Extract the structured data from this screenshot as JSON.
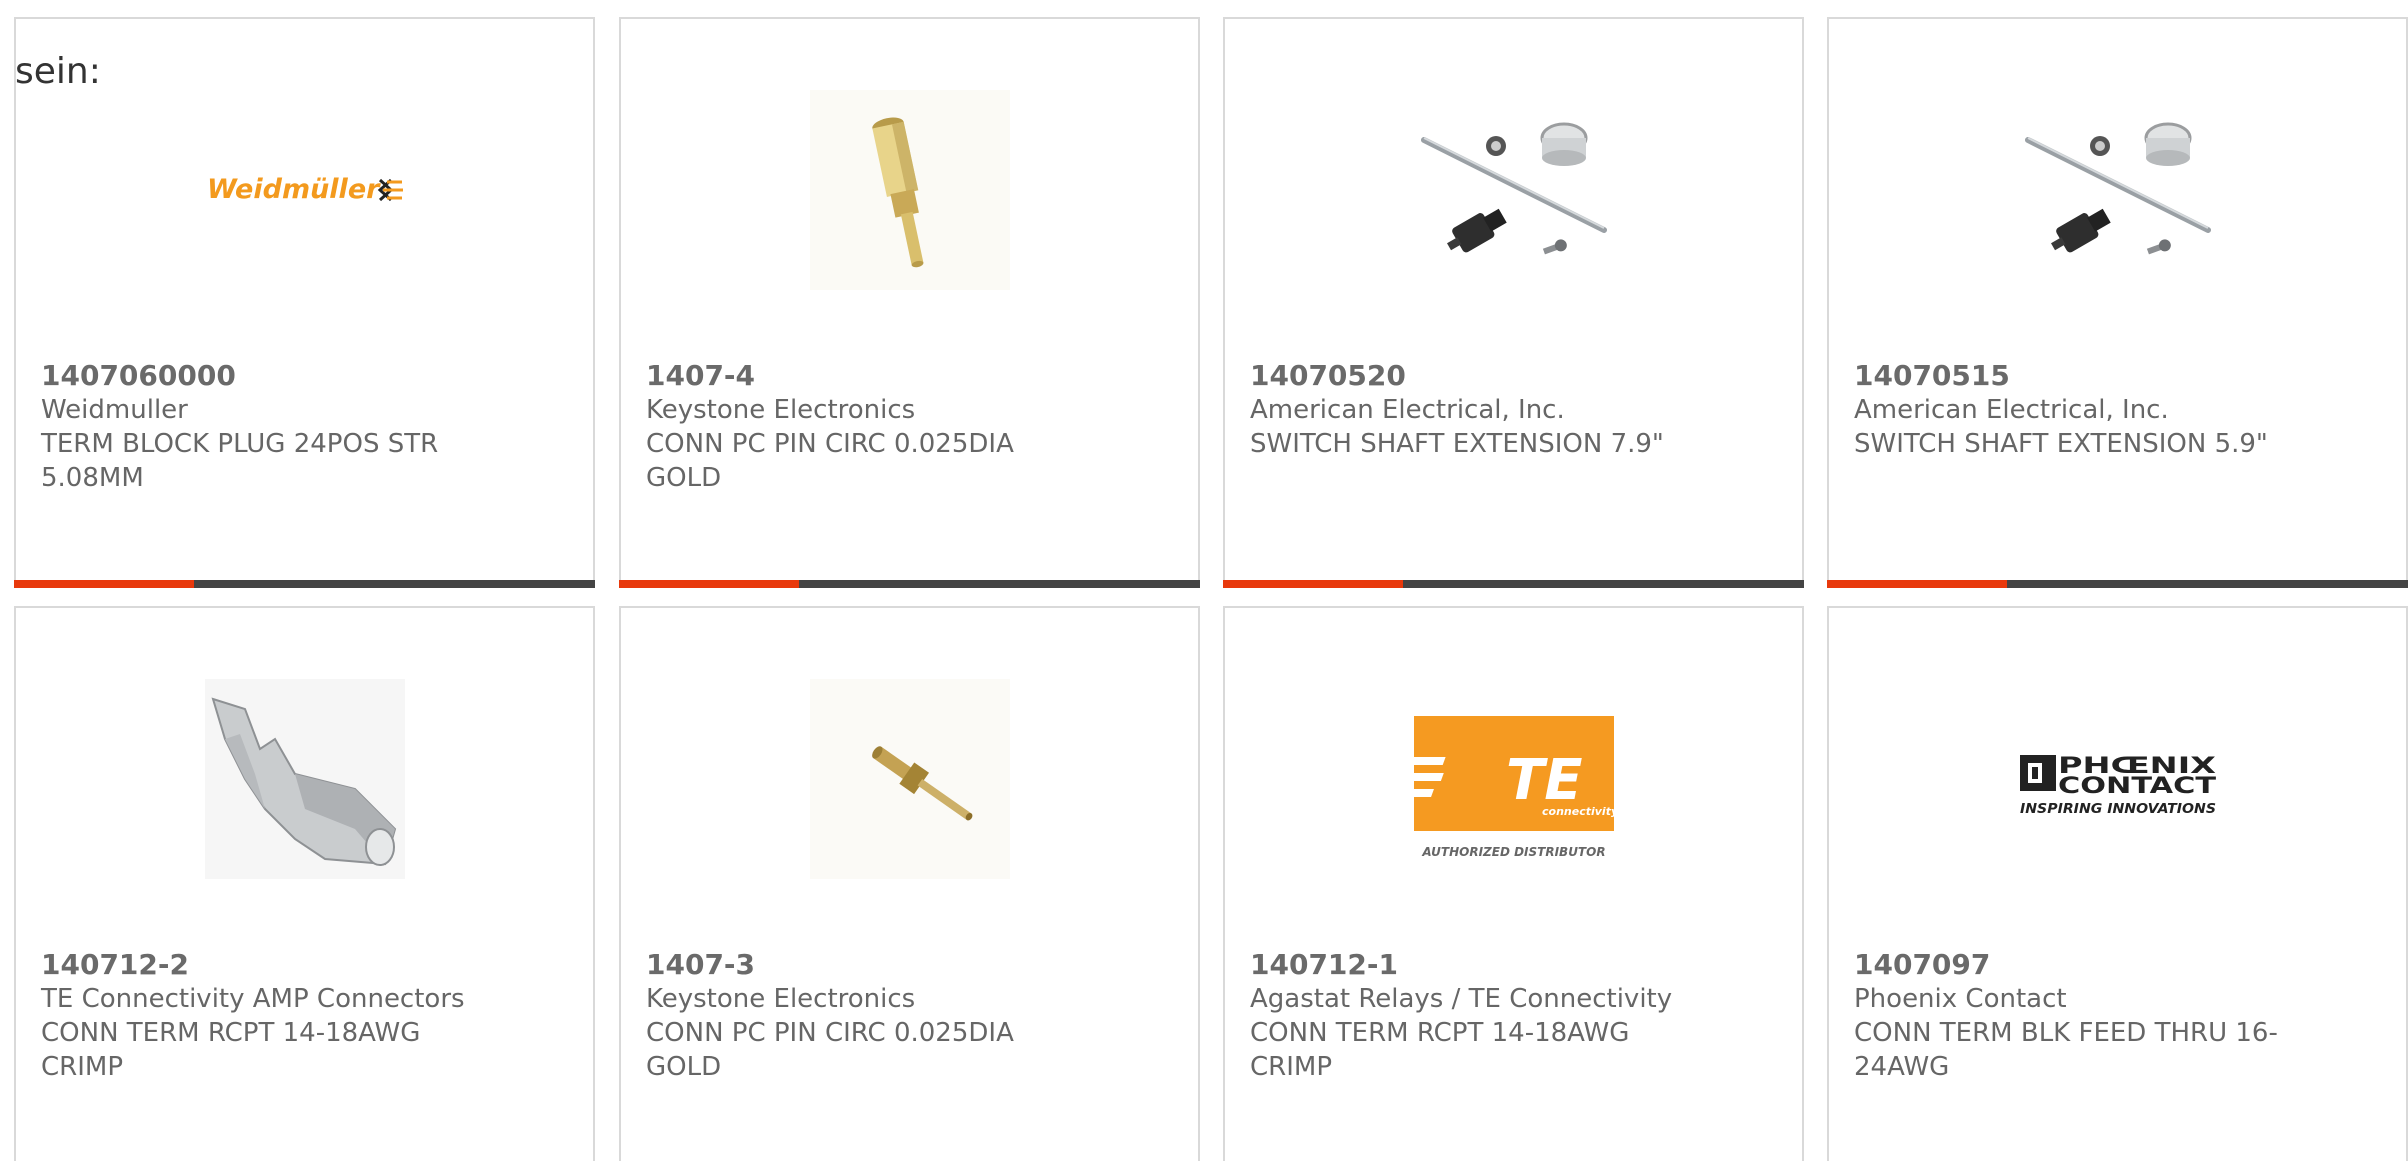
{
  "leading_text": "sein:",
  "colors": {
    "accent": "#e8390c",
    "track": "#444444",
    "text": "#666666",
    "border": "#d9d9d9",
    "weidmuller_orange": "#f39a1e",
    "te_orange": "#f59a21"
  },
  "products": [
    {
      "part_number": "1407060000",
      "manufacturer": "Weidmuller",
      "description_line1": "TERM BLOCK PLUG 24POS STR",
      "description_line2": "5.08MM",
      "image": "weidmuller-logo",
      "logo_text": "Weidmüller",
      "progress": 0.31
    },
    {
      "part_number": "1407-4",
      "manufacturer": "Keystone Electronics",
      "description_line1": "CONN PC PIN CIRC 0.025DIA",
      "description_line2": "GOLD",
      "image": "gold-pin-large",
      "progress": 0.31
    },
    {
      "part_number": "14070520",
      "manufacturer": "American Electrical, Inc.",
      "description_line1": "SWITCH SHAFT EXTENSION 7.9\"",
      "description_line2": "",
      "image": "shaft-extension-kit",
      "progress": 0.31
    },
    {
      "part_number": "14070515",
      "manufacturer": "American Electrical, Inc.",
      "description_line1": "SWITCH SHAFT EXTENSION 5.9\"",
      "description_line2": "",
      "image": "shaft-extension-kit",
      "progress": 0.31
    },
    {
      "part_number": "140712-2",
      "manufacturer": "TE Connectivity AMP Connectors",
      "description_line1": "CONN TERM RCPT 14-18AWG",
      "description_line2": "CRIMP",
      "image": "crimp-receptacle",
      "progress": 0
    },
    {
      "part_number": "1407-3",
      "manufacturer": "Keystone Electronics",
      "description_line1": "CONN PC PIN CIRC 0.025DIA",
      "description_line2": "GOLD",
      "image": "gold-pin-small",
      "progress": 0
    },
    {
      "part_number": "140712-1",
      "manufacturer": "Agastat Relays / TE Connectivity",
      "description_line1": "CONN TERM RCPT 14-18AWG",
      "description_line2": "CRIMP",
      "image": "te-logo",
      "logo_text": "TE",
      "logo_subtext": "connectivity",
      "logo_caption": "AUTHORIZED DISTRIBUTOR",
      "progress": 0
    },
    {
      "part_number": "1407097",
      "manufacturer": "Phoenix Contact",
      "description_line1": "CONN TERM BLK FEED THRU 16-",
      "description_line2": "24AWG",
      "image": "phoenix-contact-logo",
      "logo_text_1": "PHŒNIX",
      "logo_text_2": "CONTACT",
      "logo_tagline": "INSPIRING INNOVATIONS",
      "progress": 0
    }
  ]
}
